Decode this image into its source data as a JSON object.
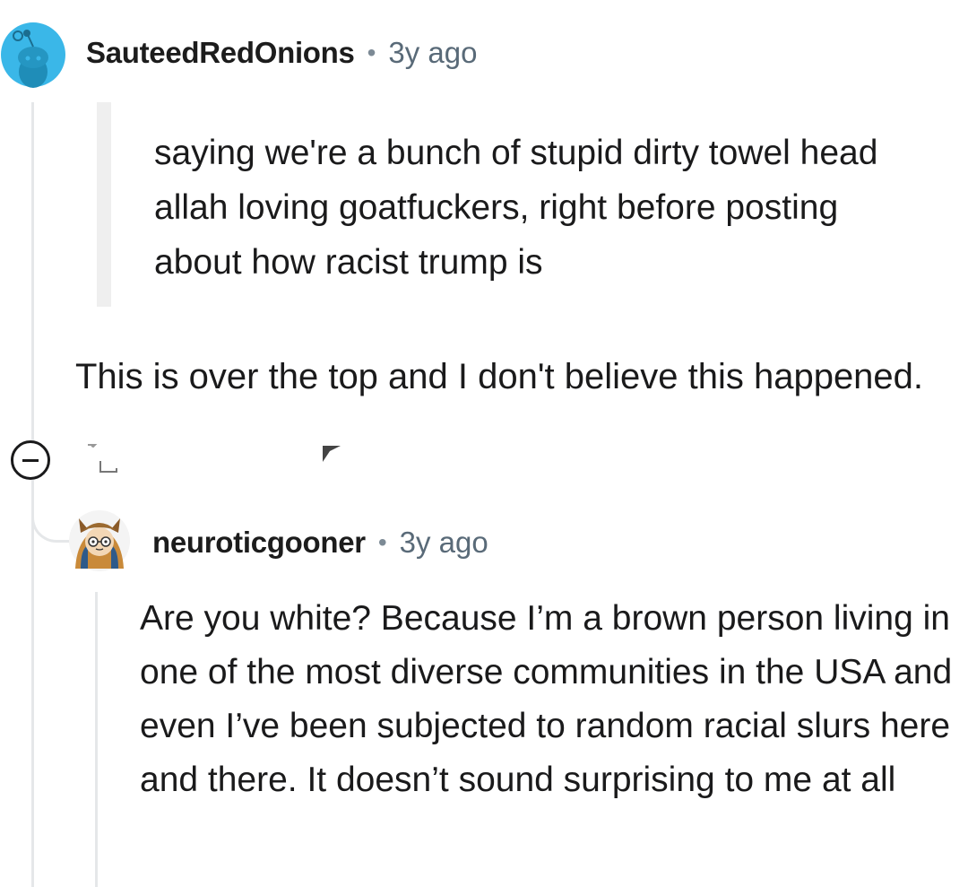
{
  "comment1": {
    "username": "SauteedRedOnions",
    "separator": "•",
    "timestamp": "3y ago",
    "avatar_icon": "reddit-snoo-avatar",
    "quote": "saying we're a bunch of stupid dirty towel head allah loving goatfuckers, right before posting about how racist trump is",
    "body": "This is over the top and I don't believe this happened."
  },
  "controls": {
    "collapse_icon": "minus-circle-icon"
  },
  "comment2": {
    "username": "neuroticgooner",
    "separator": "•",
    "timestamp": "3y ago",
    "avatar_icon": "owl-hood-avatar",
    "body": "Are you white? Because I’m a brown person living in one of the most diverse communities in the USA and even I’ve been subjected to random racial slurs here and there. It doesn’t sound surprising to me at all"
  },
  "colors": {
    "text": "#1a1a1b",
    "meta": "#596a78",
    "thread_line": "#e5e7e9",
    "snoo_bg": "#3ab7e8"
  }
}
